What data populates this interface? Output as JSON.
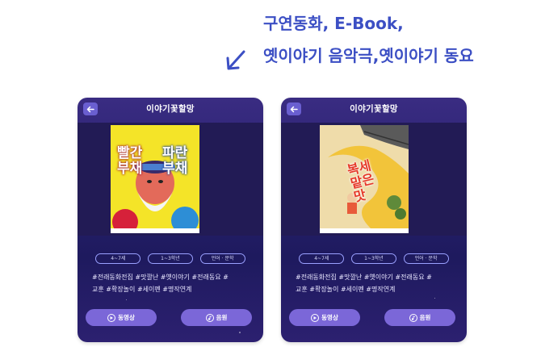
{
  "headline": {
    "line1": "구연동화, E-Book,",
    "line2": "옛이야기 음악극,옛이야기 동요"
  },
  "cards": [
    {
      "title": "이야기꽃할망",
      "cover_title_left": "빨간\n부채",
      "cover_title_right": "파란\n부채",
      "tags": [
        "4~7세",
        "1~3학년",
        "언어 · 문학"
      ],
      "hashtags_line1": "#전래동화전집 #맛깔난 #옛이야기 #전래동요 #",
      "hashtags_line2": "교훈 #확장놀이 #세이펜 #명작연계",
      "video_label": "동영상",
      "audio_label": "음원"
    },
    {
      "title": "이야기꽃할망",
      "cover_title": "복세\n맡은\n맛",
      "tags": [
        "4~7세",
        "1~3학년",
        "언어 · 문학"
      ],
      "hashtags_line1": "#전래동화전집 #맛깔난 #옛이야기 #전래동요 #",
      "hashtags_line2": "교훈 #확장놀이 #세이펜 #명작연계",
      "video_label": "동영상",
      "audio_label": "음원"
    }
  ],
  "colors": {
    "headline": "#3c4fc4",
    "card_bg": "#2a2272",
    "button": "#7b67d8"
  },
  "icons": [
    "arrow-down-left-icon",
    "back-arrow-icon",
    "play-icon",
    "music-icon"
  ]
}
